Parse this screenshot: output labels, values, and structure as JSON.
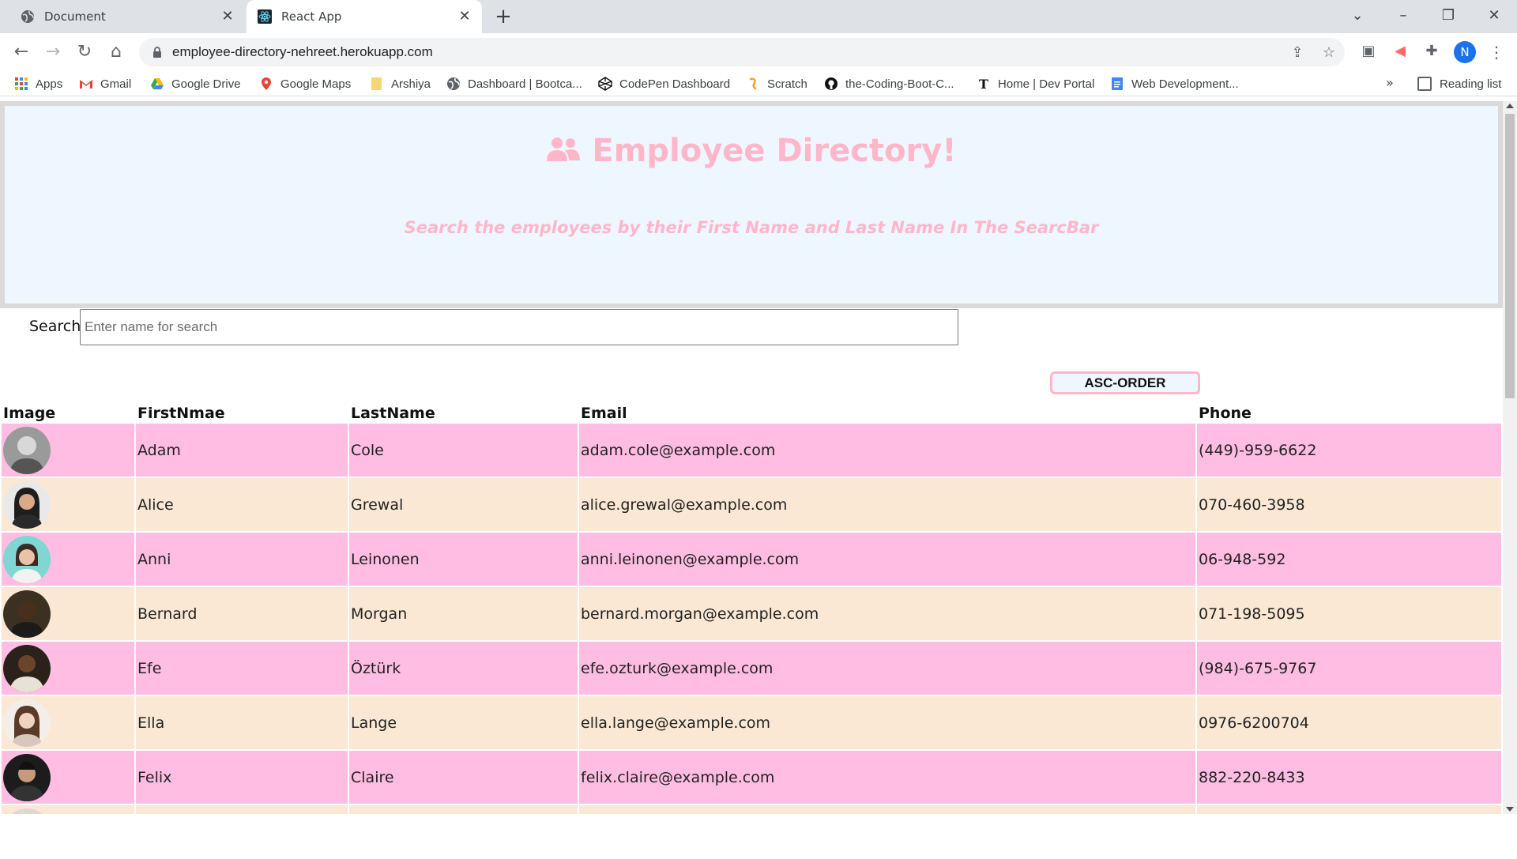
{
  "browser": {
    "tabs": [
      {
        "title": "Document"
      },
      {
        "title": "React App"
      }
    ],
    "url": "employee-directory-nehreet.herokuapp.com",
    "profile_initial": "N",
    "bookmarks": [
      {
        "label": "Apps"
      },
      {
        "label": "Gmail"
      },
      {
        "label": "Google Drive"
      },
      {
        "label": "Google Maps"
      },
      {
        "label": "Arshiya"
      },
      {
        "label": "Dashboard | Bootca..."
      },
      {
        "label": "CodePen Dashboard"
      },
      {
        "label": "Scratch"
      },
      {
        "label": "the-Coding-Boot-C..."
      },
      {
        "label": "Home | Dev Portal"
      },
      {
        "label": "Web Development..."
      }
    ],
    "more_bookmarks": "»",
    "reading_list": "Reading list"
  },
  "header": {
    "title": "Employee Directory!",
    "subtitle": "Search the employees by their First Name and Last Name In The SearcBar"
  },
  "search": {
    "label": "Search:",
    "placeholder": "Enter name for search",
    "value": ""
  },
  "sort_button": "ASC-ORDER",
  "table": {
    "headers": {
      "image": "Image",
      "first": "FirstNmae",
      "last": "LastName",
      "email": "Email",
      "phone": "Phone"
    },
    "rows": [
      {
        "first": "Adam",
        "last": "Cole",
        "email": "adam.cole@example.com",
        "phone": "(449)-959-6622"
      },
      {
        "first": "Alice",
        "last": "Grewal",
        "email": "alice.grewal@example.com",
        "phone": "070-460-3958"
      },
      {
        "first": "Anni",
        "last": "Leinonen",
        "email": "anni.leinonen@example.com",
        "phone": "06-948-592"
      },
      {
        "first": "Bernard",
        "last": "Morgan",
        "email": "bernard.morgan@example.com",
        "phone": "071-198-5095"
      },
      {
        "first": "Efe",
        "last": "Öztürk",
        "email": "efe.ozturk@example.com",
        "phone": "(984)-675-9767"
      },
      {
        "first": "Ella",
        "last": "Lange",
        "email": "ella.lange@example.com",
        "phone": "0976-6200704"
      },
      {
        "first": "Felix",
        "last": "Claire",
        "email": "felix.claire@example.com",
        "phone": "882-220-8433"
      },
      {
        "first": "",
        "last": "",
        "email": "",
        "phone": ""
      }
    ]
  },
  "colors": {
    "accent_pink": "#ffb6c8",
    "row_pink": "#ffbde3",
    "row_tan": "#fae8d4",
    "jumbotron_bg": "#eef6ff"
  }
}
